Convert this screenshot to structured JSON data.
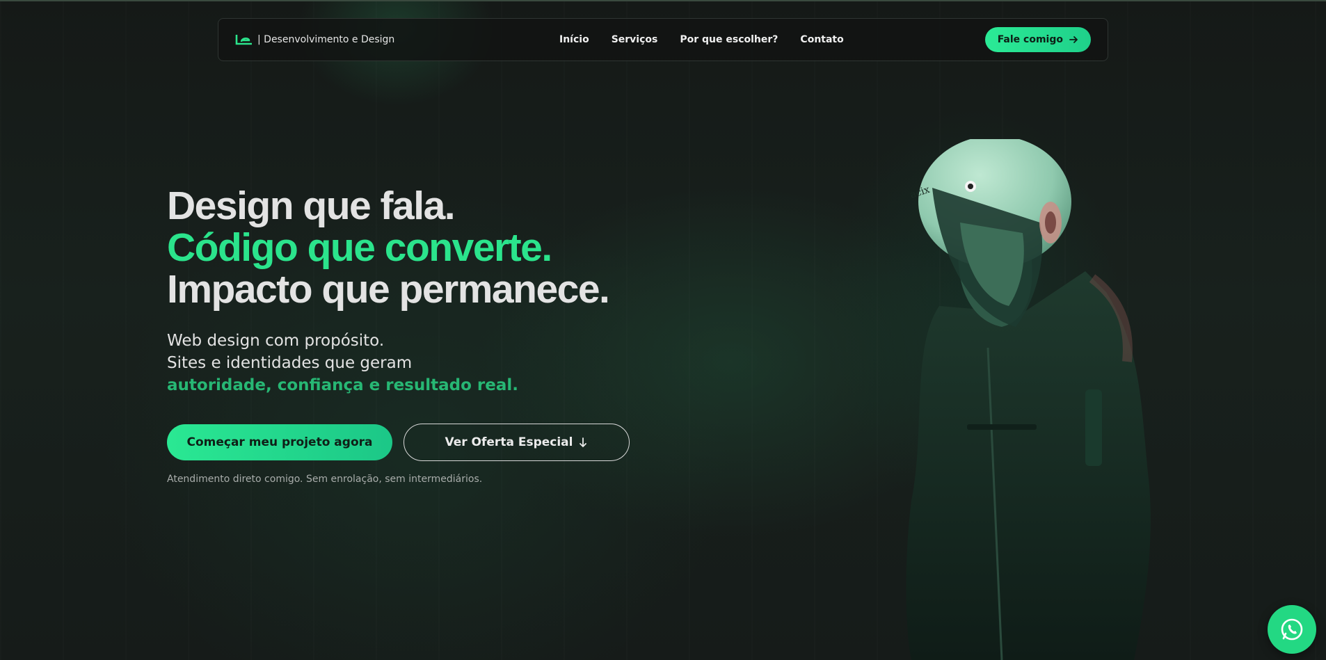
{
  "brand": {
    "name": "| Desenvolvimento e Design",
    "logo_icon": "le-logo-icon",
    "accent": "#2be48c"
  },
  "nav": {
    "links": [
      "Início",
      "Serviços",
      "Por que escolher?",
      "Contato"
    ],
    "cta_label": "Fale comigo",
    "cta_icon": "arrow-right-icon"
  },
  "hero": {
    "line1": "Design que fala.",
    "line2": "Código que converte.",
    "line3": "Impacto que permanece.",
    "sub1": "Web design com propósito.",
    "sub2": "Sites e identidades que geram",
    "sub_accent": "autoridade, confiança e resultado real.",
    "primary_label": "Começar meu projeto agora",
    "secondary_label": "Ver Oferta Especial",
    "secondary_icon": "arrow-down-icon",
    "note": "Atendimento direto comigo. Sem enrolação, sem intermediários.",
    "helmet_text": "acix"
  },
  "whatsapp": {
    "icon": "whatsapp-icon",
    "color": "#23d883"
  }
}
